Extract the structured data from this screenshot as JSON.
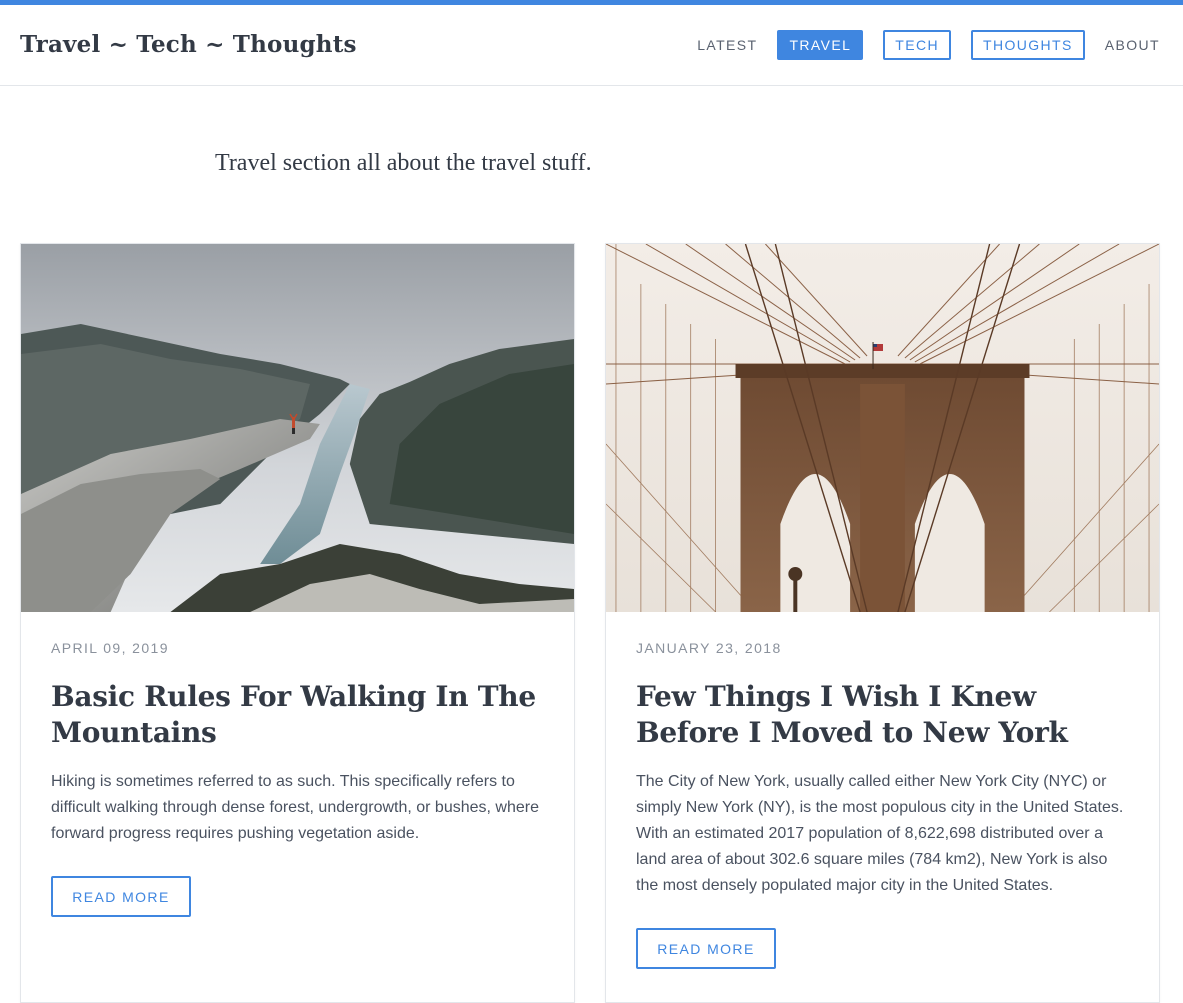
{
  "header": {
    "brand": "Travel ~ Tech ~ Thoughts",
    "nav": [
      {
        "label": "LATEST",
        "state": "plain"
      },
      {
        "label": "TRAVEL",
        "state": "active"
      },
      {
        "label": "TECH",
        "state": "outline"
      },
      {
        "label": "THOUGHTS",
        "state": "outline"
      },
      {
        "label": "ABOUT",
        "state": "plain"
      }
    ]
  },
  "intro": "Travel section all about the travel stuff.",
  "posts": [
    {
      "date": "APRIL 09, 2019",
      "title": "Basic Rules For Walking In The Mountains",
      "excerpt": "Hiking is sometimes referred to as such. This specifically refers to difficult walking through dense forest, undergrowth, or bushes, where forward progress requires pushing vegetation aside.",
      "button": "READ MORE",
      "image": "mountain-fjord-photo"
    },
    {
      "date": "JANUARY 23, 2018",
      "title": "Few Things I Wish I Knew Before I Moved to New York",
      "excerpt": "The City of New York, usually called either New York City (NYC) or simply New York (NY), is the most populous city in the United States. With an estimated 2017 population of 8,622,698 distributed over a land area of about 302.6 square miles (784 km2), New York is also the most densely populated major city in the United States.",
      "button": "READ MORE",
      "image": "brooklyn-bridge-photo"
    }
  ],
  "colors": {
    "accent": "#3f86e0",
    "text": "#333a45",
    "muted": "#8a919c"
  }
}
